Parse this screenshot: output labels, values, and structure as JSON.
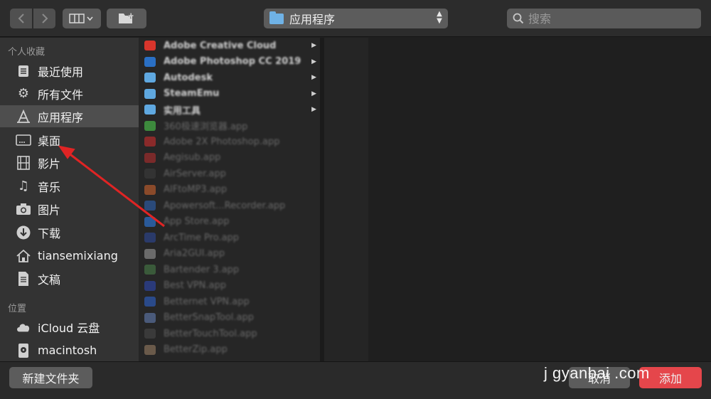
{
  "toolbar": {
    "view_icon": "column-view-icon",
    "location": "应用程序",
    "search_placeholder": "搜索"
  },
  "sidebar": {
    "favorites_heading": "个人收藏",
    "favorites": [
      {
        "label": "最近使用",
        "icon": "recents-icon"
      },
      {
        "label": "所有文件",
        "icon": "gear-icon"
      },
      {
        "label": "应用程序",
        "icon": "applications-icon",
        "selected": true
      },
      {
        "label": "桌面",
        "icon": "desktop-icon"
      },
      {
        "label": "影片",
        "icon": "film-icon"
      },
      {
        "label": "音乐",
        "icon": "music-note-icon"
      },
      {
        "label": "图片",
        "icon": "camera-icon"
      },
      {
        "label": "下载",
        "icon": "download-icon"
      },
      {
        "label": "tiansemixiang",
        "icon": "home-icon"
      },
      {
        "label": "文稿",
        "icon": "document-icon"
      }
    ],
    "locations_heading": "位置",
    "locations": [
      {
        "label": "iCloud 云盘",
        "icon": "cloud-icon"
      },
      {
        "label": "macintosh",
        "icon": "disk-icon"
      }
    ]
  },
  "files": [
    {
      "name": "Adobe Creative Cloud",
      "kind": "folder",
      "color": "#d8352c"
    },
    {
      "name": "Adobe Photoshop CC 2019",
      "kind": "folder",
      "color": "#2a6fc4"
    },
    {
      "name": "Autodesk",
      "kind": "folder",
      "color": "#5fa8e0"
    },
    {
      "name": "SteamEmu",
      "kind": "folder",
      "color": "#5fa8e0"
    },
    {
      "name": "实用工具",
      "kind": "folder",
      "color": "#5fa8e0"
    },
    {
      "name": "360极速浏览器.app",
      "kind": "app",
      "color": "#3d8a3d"
    },
    {
      "name": "Adobe 2X Photoshop.app",
      "kind": "app",
      "color": "#8a2a2a"
    },
    {
      "name": "Aegisub.app",
      "kind": "app",
      "color": "#7a2a2a"
    },
    {
      "name": "AirServer.app",
      "kind": "app",
      "color": "#333333"
    },
    {
      "name": "AIFtoMP3.app",
      "kind": "app",
      "color": "#8a4a2a"
    },
    {
      "name": "Apowersoft...Recorder.app",
      "kind": "app",
      "color": "#2a4a7a"
    },
    {
      "name": "App Store.app",
      "kind": "app",
      "color": "#2a5a9a"
    },
    {
      "name": "ArcTime Pro.app",
      "kind": "app",
      "color": "#2a3a6a"
    },
    {
      "name": "Aria2GUI.app",
      "kind": "app",
      "color": "#6a6a6a"
    },
    {
      "name": "Bartender 3.app",
      "kind": "app",
      "color": "#3a5a3a"
    },
    {
      "name": "Best VPN.app",
      "kind": "app",
      "color": "#2a3a7a"
    },
    {
      "name": "Betternet VPN.app",
      "kind": "app",
      "color": "#2a4a8a"
    },
    {
      "name": "BetterSnapTool.app",
      "kind": "app",
      "color": "#4a5a7a"
    },
    {
      "name": "BetterTouchTool.app",
      "kind": "app",
      "color": "#3a3a3a"
    },
    {
      "name": "BetterZip.app",
      "kind": "app",
      "color": "#6a5a4a"
    }
  ],
  "bottom": {
    "new_folder": "新建文件夹",
    "cancel": "取消",
    "add": "添加",
    "watermark": "j gyanbai .com"
  },
  "colors": {
    "accent_add": "#e5464b",
    "annotation_arrow": "#e02424",
    "folder_blue": "#6fb2e6"
  }
}
